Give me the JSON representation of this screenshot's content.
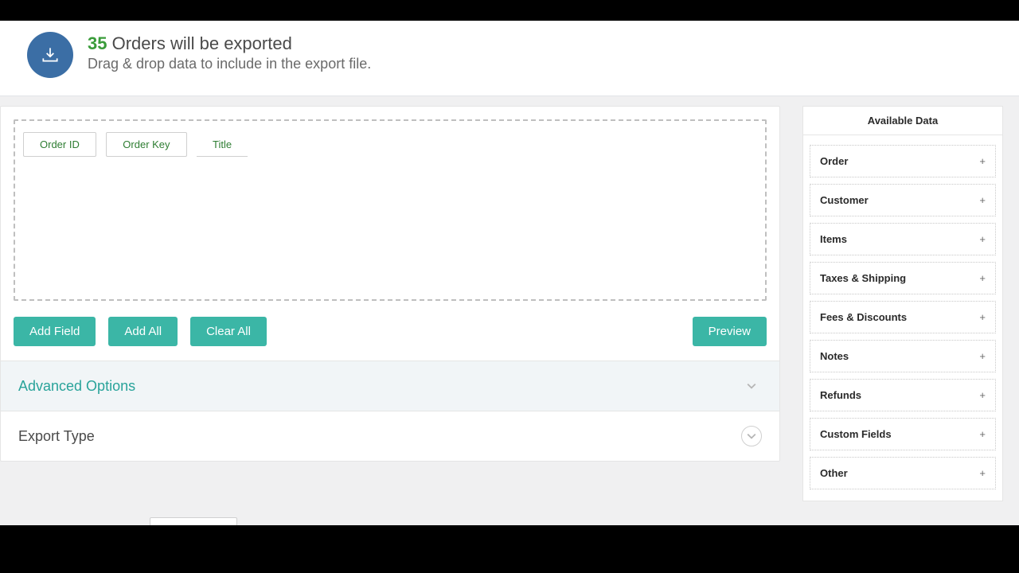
{
  "header": {
    "count": "35",
    "title_rest": " Orders will be exported",
    "subtitle": "Drag & drop data to include in the export file."
  },
  "dropzone": {
    "chips": [
      "Order ID",
      "Order Key",
      "Title"
    ]
  },
  "buttons": {
    "add_field": "Add Field",
    "add_all": "Add All",
    "clear_all": "Clear All",
    "preview": "Preview"
  },
  "sections": {
    "advanced": "Advanced Options",
    "export_type": "Export Type"
  },
  "sidebar": {
    "title": "Available Data",
    "items": [
      "Order",
      "Customer",
      "Items",
      "Taxes & Shipping",
      "Fees & Discounts",
      "Notes",
      "Refunds",
      "Custom Fields",
      "Other"
    ]
  }
}
